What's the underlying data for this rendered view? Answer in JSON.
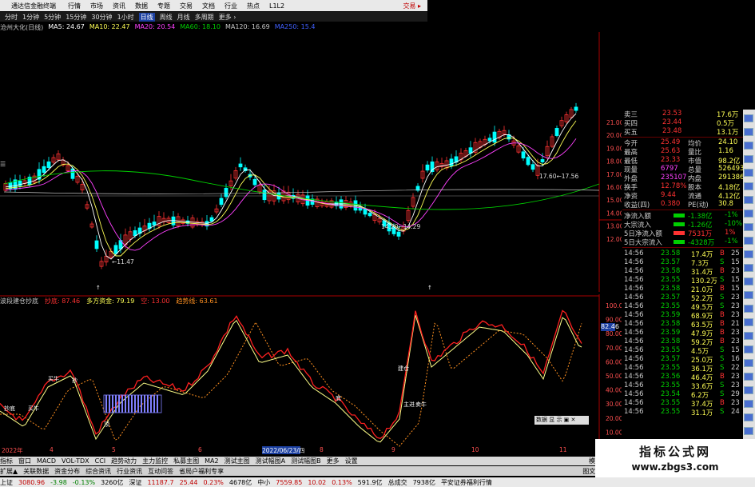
{
  "menu": {
    "title": "通达信金融终端",
    "items": [
      "行情",
      "市场",
      "资讯",
      "数据",
      "专题",
      "交易",
      "文档",
      "行业",
      "热点",
      "L1L2"
    ],
    "right": "交易 ▸"
  },
  "periods": {
    "items": [
      "分时",
      "1分钟",
      "5分钟",
      "15分钟",
      "30分钟",
      "1小时",
      "日线",
      "周线",
      "月线",
      "多周期",
      "更多 ›"
    ],
    "active_index": 6
  },
  "ma_line": {
    "name": "沧州大化(日线)",
    "items": [
      {
        "label": "MA5: 24.67",
        "color": "#ffffff"
      },
      {
        "label": "MA10: 22.47",
        "color": "#ffff55"
      },
      {
        "label": "MA20: 20.54",
        "color": "#ff40ff"
      },
      {
        "label": "MA60: 18.10",
        "color": "#00d000"
      },
      {
        "label": "MA120: 16.69",
        "color": "#c8c8c8"
      },
      {
        "label": "MA250: 15.4",
        "color": "#4060ff"
      }
    ]
  },
  "chart_annotations": {
    "high": "21.00",
    "low1": "←11.47",
    "low2": "14.20←14.29",
    "level": "17.60←17.56",
    "marker1": "↑",
    "marker2": "↑"
  },
  "price_axis": [
    "21.00",
    "20.00",
    "19.00",
    "18.00",
    "17.00",
    "16.00",
    "15.00",
    "14.00",
    "13.00",
    "12.00"
  ],
  "indicator": {
    "name": "波段建仓抄底",
    "items": [
      {
        "label": "抄底: 87.46",
        "color": "#ff3232"
      },
      {
        "label": "多方资金: 79.19",
        "color": "#ffff55"
      },
      {
        "label": "空: 13.00",
        "color": "#ff3232"
      },
      {
        "label": "趋势线: 63.61",
        "color": "#ff9020"
      }
    ],
    "axis": [
      "100.0",
      "90.00",
      "80.00",
      "70.00",
      "60.00",
      "50.00",
      "40.00",
      "30.00",
      "20.00",
      "10.00",
      "0.00"
    ],
    "price_box": "82.46",
    "labels": [
      "买牛",
      "抄底",
      "买牛",
      "顶",
      "底",
      "主进",
      "建仓",
      "卖牛",
      "抄"
    ]
  },
  "right_panel": {
    "asks": [
      {
        "name": "卖三",
        "price": "23.53",
        "vol": "17.6万"
      },
      {
        "name": "买四",
        "price": "23.44",
        "vol": "0.5万"
      },
      {
        "name": "买五",
        "price": "23.48",
        "vol": "13.1万"
      }
    ],
    "stats": [
      {
        "k1": "今开",
        "v1": "25.49",
        "k2": "均价",
        "v2": "24.10"
      },
      {
        "k1": "最高",
        "v1": "25.63",
        "k2": "量比",
        "v2": "1.16"
      },
      {
        "k1": "最低",
        "v1": "23.33",
        "k2": "市值",
        "v2": "98.2亿"
      },
      {
        "k1": "现量",
        "v1": "6797",
        "k2": "总量",
        "v2": "526493"
      },
      {
        "k1": "外盘",
        "v1": "235107",
        "k2": "内盘",
        "v2": "291386"
      },
      {
        "k1": "换手",
        "v1": "12.78%",
        "k2": "股本",
        "v2": "4.18亿"
      },
      {
        "k1": "净资",
        "v1": "9.44",
        "k2": "流通",
        "v2": "4.12亿"
      },
      {
        "k1": "收益(四)",
        "v1": "0.380",
        "k2": "PE(动)",
        "v2": "30.8"
      }
    ],
    "flows": [
      {
        "k": "净流入额",
        "v": "-1.38亿",
        "pct": "-1%"
      },
      {
        "k": "大宗流入",
        "v": "-1.26亿",
        "pct": "-10%"
      },
      {
        "k": "5日净流入额",
        "v": "7531万",
        "pct": "1%"
      },
      {
        "k": "5日大宗流入",
        "v": "-4328万",
        "pct": "-1%"
      }
    ],
    "ticks": [
      {
        "t": "14:56",
        "p": "23.58",
        "v": "17.4万",
        "s": "B",
        "n": "25"
      },
      {
        "t": "14:56",
        "p": "23.57",
        "v": "7.3万",
        "s": "S",
        "n": "15"
      },
      {
        "t": "14:56",
        "p": "23.58",
        "v": "31.4万",
        "s": "B",
        "n": "23"
      },
      {
        "t": "14:56",
        "p": "23.55",
        "v": "130.2万",
        "s": "S",
        "n": "15"
      },
      {
        "t": "14:56",
        "p": "23.58",
        "v": "21.0万",
        "s": "B",
        "n": "15"
      },
      {
        "t": "14:56",
        "p": "23.57",
        "v": "52.2万",
        "s": "S",
        "n": "23"
      },
      {
        "t": "14:56",
        "p": "23.55",
        "v": "49.5万",
        "s": "S",
        "n": "23"
      },
      {
        "t": "14:56",
        "p": "23.59",
        "v": "68.9万",
        "s": "B",
        "n": "23"
      },
      {
        "t": "14:56",
        "p": "23.58",
        "v": "63.5万",
        "s": "B",
        "n": "21"
      },
      {
        "t": "14:56",
        "p": "23.59",
        "v": "47.9万",
        "s": "B",
        "n": "23"
      },
      {
        "t": "14:56",
        "p": "23.58",
        "v": "59.2万",
        "s": "B",
        "n": "23"
      },
      {
        "t": "14:56",
        "p": "23.55",
        "v": "4.5万",
        "s": "S",
        "n": "15"
      },
      {
        "t": "14:56",
        "p": "23.57",
        "v": "25.0万",
        "s": "S",
        "n": "16"
      },
      {
        "t": "14:56",
        "p": "23.55",
        "v": "36.1万",
        "s": "S",
        "n": "22"
      },
      {
        "t": "14:56",
        "p": "23.56",
        "v": "46.4万",
        "s": "B",
        "n": "23"
      },
      {
        "t": "14:56",
        "p": "23.55",
        "v": "33.6万",
        "s": "S",
        "n": "23"
      },
      {
        "t": "14:56",
        "p": "23.54",
        "v": "6.2万",
        "s": "S",
        "n": "29"
      },
      {
        "t": "14:56",
        "p": "23.55",
        "v": "37.4万",
        "s": "B",
        "n": "23"
      },
      {
        "t": "14:56",
        "p": "23.55",
        "v": "31.1万",
        "s": "S",
        "n": "24"
      }
    ]
  },
  "x_axis": {
    "labels": [
      "2022年",
      "4",
      "5",
      "6",
      "7",
      "8",
      "9",
      "10",
      "11"
    ],
    "cursor_date": "2022/06/23/四"
  },
  "mini_panel": "数据 显 示 ▣ ✕",
  "bottom_tabs": [
    "指标",
    "窗口",
    "MACD",
    "VOL-TDX",
    "CCI",
    "趋势动力",
    "主力监控",
    "私募主图",
    "MA2",
    "测试主图",
    "测试幅图A",
    "测试幅图B",
    "更多",
    "设置"
  ],
  "bottom_right": "模板",
  "bottom_left_row": [
    "扩展▲",
    "关联数据",
    "资金分布",
    "综合资讯",
    "行业资讯",
    "互动问答",
    "省局户福利专享"
  ],
  "bottom_right_row": "图文F10",
  "status": [
    {
      "label": "上证",
      "color": "#000"
    },
    {
      "label": "3080.96",
      "color": "#c00000"
    },
    {
      "label": "-3.98",
      "color": "#008000"
    },
    {
      "label": "-0.13%",
      "color": "#008000"
    },
    {
      "label": "3260亿",
      "color": "#000"
    },
    {
      "label": "深证",
      "color": "#000"
    },
    {
      "label": "11187.7",
      "color": "#c00000"
    },
    {
      "label": "25.44",
      "color": "#c00000"
    },
    {
      "label": "0.23%",
      "color": "#c00000"
    },
    {
      "label": "4678亿",
      "color": "#000"
    },
    {
      "label": "中小",
      "color": "#000"
    },
    {
      "label": "7559.85",
      "color": "#c00000"
    },
    {
      "label": "10.02",
      "color": "#c00000"
    },
    {
      "label": "0.13%",
      "color": "#c00000"
    },
    {
      "label": "591.9亿",
      "color": "#000"
    },
    {
      "label": "总成交",
      "color": "#000"
    },
    {
      "label": "7938亿",
      "color": "#000"
    },
    {
      "label": "平安证券福利行情",
      "color": "#000"
    }
  ],
  "watermark": {
    "title": "指标公式网",
    "url": "www.zbgs3.com"
  },
  "colors": {
    "up": "#ff3232",
    "down": "#00ffff",
    "panel_bg": "#000000",
    "accent": "#1b3fa0"
  }
}
